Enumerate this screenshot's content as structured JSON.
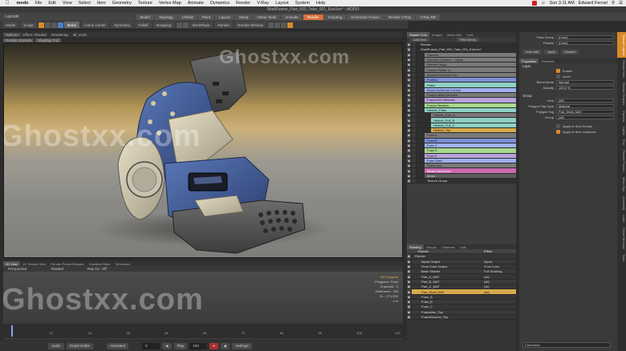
{
  "mac_menu": {
    "app": "modo",
    "items": [
      "File",
      "Edit",
      "View",
      "Select",
      "Item",
      "Geometry",
      "Texture",
      "Vertex Map",
      "Animate",
      "Dynamics",
      "Render",
      "V-Ray",
      "Layout",
      "System",
      "Help"
    ],
    "clock": "Sun 3:11 AM",
    "user": "Edward Ferrari"
  },
  "window_title": "ShellFusion_Part_003_Take_001_End.lxo* - MODO",
  "layouts": {
    "label": "Layouts",
    "tabs": [
      "Model",
      "Topology",
      "UVEdit",
      "Paint",
      "Layout",
      "Setup",
      "Game Tools",
      "Animate",
      "Render",
      "Scripting",
      "Schematic Fusion",
      "Render V-Ray",
      "V-Ray RB"
    ],
    "active": "Render"
  },
  "toolbar": {
    "items": [
      "Model",
      "Sculpt",
      "Items",
      "Action Center",
      "Symmetry",
      "Falloff",
      "Snapping",
      "WorkPlane",
      "Render",
      "Render Window"
    ]
  },
  "viewport": {
    "tabs": [
      "Options",
      "Effect: Shaded",
      "Rendering",
      "ldf_end2"
    ],
    "sub": [
      "Render Camera",
      "Shading: Full"
    ]
  },
  "watermarks": [
    "Ghostxx.com",
    "Ghostxx.com",
    "Ghostxx.com"
  ],
  "shader_tree": {
    "tabs": [
      "Shader Tree",
      "Images",
      "Mesh Ops",
      "Lists"
    ],
    "add_label": "Add Item",
    "filter_label": "Filter Items",
    "rows": [
      {
        "label": "Render",
        "style": "c-none"
      },
      {
        "label": "ShellFusion_Part_003_Take_001_End.lxo*",
        "style": "c-none"
      },
      {
        "label": "Camera",
        "style": "c-gray"
      },
      {
        "label": "Intersect Camera - Lights",
        "style": "c-gray"
      },
      {
        "label": "Render Stage",
        "style": "c-gray"
      },
      {
        "label": "Fusion Profile UI",
        "style": "c-gray"
      },
      {
        "label": "Imported-Default Geo",
        "style": "c-gray"
      },
      {
        "label": "Profiles",
        "style": "c-blue"
      },
      {
        "label": "Paths",
        "style": "c-teal"
      },
      {
        "label": "Blank-Bulkhead Insures",
        "style": "c-lblue"
      },
      {
        "label": "Fusion Mixer Meshes",
        "style": "c-gray"
      },
      {
        "label": "Fusion B-K Meshes",
        "style": "c-purple"
      },
      {
        "label": "Fusion Meshes",
        "style": "c-green"
      },
      {
        "label": "Helmet_Parts",
        "style": "c-teal"
      },
      {
        "label": "Helmet_Part_A",
        "style": "c-gray"
      },
      {
        "label": "Helmet_Full_B",
        "style": "c-teal"
      },
      {
        "label": "Helmet_Full_C",
        "style": "c-teal"
      },
      {
        "label": "Helmet_Top",
        "style": "c-sel"
      },
      {
        "label": "Fuse A",
        "style": "c-gray"
      },
      {
        "label": "Fuse B",
        "style": "c-blue"
      },
      {
        "label": "Fuse C",
        "style": "c-lblue"
      },
      {
        "label": "Fuse D",
        "style": "c-green"
      },
      {
        "label": "Fuse E",
        "style": "c-purple"
      },
      {
        "label": "Fuse Shell",
        "style": "c-lblue"
      },
      {
        "label": "Shell Core",
        "style": "c-gray"
      },
      {
        "label": "Blank Deformers",
        "style": "c-pink"
      },
      {
        "label": "Mesh",
        "style": "c-dgray"
      },
      {
        "label": "Texture Group",
        "style": "c-none"
      }
    ]
  },
  "shading": {
    "tabs": [
      "Shading",
      "Groups",
      "Channels",
      "Lists"
    ],
    "header": [
      "Render",
      "Effect"
    ],
    "rows": [
      {
        "label": "Render",
        "effect": ""
      },
      {
        "label": "Alpha Output",
        "effect": "Alpha"
      },
      {
        "label": "Final Color Output",
        "effect": "Final Color"
      },
      {
        "label": "Base Shader",
        "effect": "Full Shading"
      },
      {
        "label": "Part_A_MAT",
        "effect": "(all)"
      },
      {
        "label": "Part_B_MAT",
        "effect": "(all)"
      },
      {
        "label": "Part_C_MAT",
        "effect": "(all)"
      },
      {
        "label": "Part_Shell_MAT",
        "effect": "(all)"
      },
      {
        "label": "Fuse_A",
        "effect": ""
      },
      {
        "label": "Fuse_B",
        "effect": ""
      },
      {
        "label": "Fuse_C",
        "effect": ""
      },
      {
        "label": "Fusionline_Top",
        "effect": ""
      },
      {
        "label": "FusionSource_Top",
        "effect": ""
      }
    ]
  },
  "properties": {
    "top_rows": [
      {
        "key": "Pass Group",
        "val": "(none)"
      },
      {
        "key": "Passes",
        "val": "(none)"
      }
    ],
    "buttons": [
      "Auto Add",
      "Apply",
      "Discard"
    ],
    "tabs": [
      "Properties",
      "Channels"
    ],
    "layer_section": "Layer",
    "layer_rows": [
      {
        "key": "",
        "val": "Enable",
        "checkbox": true
      },
      {
        "key": "",
        "val": "Invert",
        "checkbox": false
      },
      {
        "key": "Blend Mode",
        "val": "Normal"
      },
      {
        "key": "Opacity",
        "val": "100.0 %"
      }
    ],
    "group_section": "Group",
    "group_rows": [
      {
        "key": "Item",
        "val": "(all)"
      },
      {
        "key": "Polygon Tag Type",
        "val": "Material"
      },
      {
        "key": "Polygon Tag",
        "val": "Part_Shell_MAT"
      },
      {
        "key": "Group",
        "val": "(all)"
      }
    ],
    "group_checks": [
      "Apply to Sub-Groups",
      "Apply to Item Instances"
    ]
  },
  "side_tabs": [
    "Texture Layers",
    "Render Item",
    "Render Outputs",
    "Camera",
    "Lights",
    "Env",
    "Render Passes",
    "Mesh Ops",
    "Assembly",
    "Lister",
    "Preset Browser",
    "Tools"
  ],
  "timeline": {
    "tabs": [
      "3D View",
      "UV Texture View",
      "Render Preset Browser",
      "Gradient Editor",
      "Schematic"
    ],
    "view": [
      "Perspective",
      "Shaded",
      "Ray GL: Off"
    ],
    "stats": [
      "All Polygons",
      "Polygons : Face",
      "Channels : 0",
      "Deformers : ON",
      "GL : 271,522",
      "1 m"
    ],
    "ticks": [
      "0",
      "12",
      "24",
      "36",
      "48",
      "60",
      "72",
      "84",
      "96",
      "108",
      "120"
    ]
  },
  "transport": {
    "items": [
      "Audio",
      "Graph Editor",
      "Animated",
      "Play",
      "Settings"
    ],
    "frame": "0",
    "end": "120"
  },
  "bottom_panel": {
    "label": "Command"
  }
}
